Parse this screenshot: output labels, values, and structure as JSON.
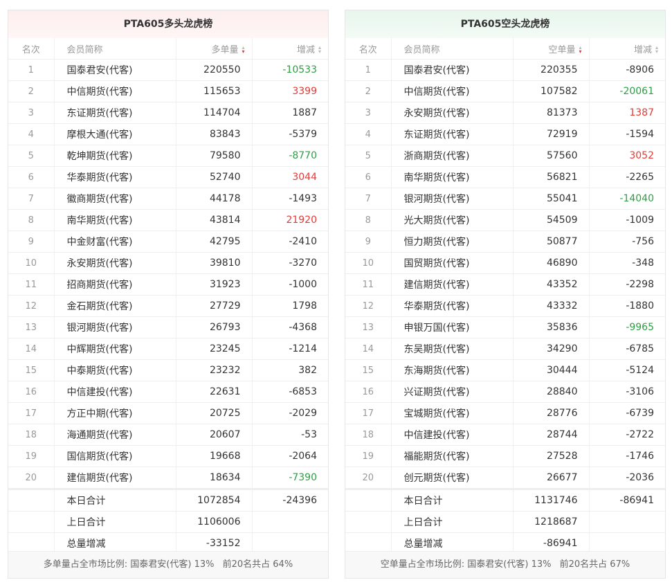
{
  "long": {
    "title": "PTA605多头龙虎榜",
    "headers": {
      "rank": "名次",
      "name": "会员简称",
      "vol": "多单量",
      "chg": "增减"
    },
    "rows": [
      {
        "rank": "1",
        "name": "国泰君安(代客)",
        "vol": "220550",
        "chg": "-10533",
        "dir": "down"
      },
      {
        "rank": "2",
        "name": "中信期货(代客)",
        "vol": "115653",
        "chg": "3399",
        "dir": "up"
      },
      {
        "rank": "3",
        "name": "东证期货(代客)",
        "vol": "114704",
        "chg": "1887",
        "dir": ""
      },
      {
        "rank": "4",
        "name": "摩根大通(代客)",
        "vol": "83843",
        "chg": "-5379",
        "dir": ""
      },
      {
        "rank": "5",
        "name": "乾坤期货(代客)",
        "vol": "79580",
        "chg": "-8770",
        "dir": "down"
      },
      {
        "rank": "6",
        "name": "华泰期货(代客)",
        "vol": "52740",
        "chg": "3044",
        "dir": "up"
      },
      {
        "rank": "7",
        "name": "徽商期货(代客)",
        "vol": "44178",
        "chg": "-1493",
        "dir": ""
      },
      {
        "rank": "8",
        "name": "南华期货(代客)",
        "vol": "43814",
        "chg": "21920",
        "dir": "up"
      },
      {
        "rank": "9",
        "name": "中金财富(代客)",
        "vol": "42795",
        "chg": "-2410",
        "dir": ""
      },
      {
        "rank": "10",
        "name": "永安期货(代客)",
        "vol": "39810",
        "chg": "-3270",
        "dir": ""
      },
      {
        "rank": "11",
        "name": "招商期货(代客)",
        "vol": "31923",
        "chg": "-1000",
        "dir": ""
      },
      {
        "rank": "12",
        "name": "金石期货(代客)",
        "vol": "27729",
        "chg": "1798",
        "dir": ""
      },
      {
        "rank": "13",
        "name": "银河期货(代客)",
        "vol": "26793",
        "chg": "-4368",
        "dir": ""
      },
      {
        "rank": "14",
        "name": "中辉期货(代客)",
        "vol": "23245",
        "chg": "-1214",
        "dir": ""
      },
      {
        "rank": "15",
        "name": "中泰期货(代客)",
        "vol": "23232",
        "chg": "382",
        "dir": ""
      },
      {
        "rank": "16",
        "name": "中信建投(代客)",
        "vol": "22631",
        "chg": "-6853",
        "dir": ""
      },
      {
        "rank": "17",
        "name": "方正中期(代客)",
        "vol": "20725",
        "chg": "-2029",
        "dir": ""
      },
      {
        "rank": "18",
        "name": "海通期货(代客)",
        "vol": "20607",
        "chg": "-53",
        "dir": ""
      },
      {
        "rank": "19",
        "name": "国信期货(代客)",
        "vol": "19668",
        "chg": "-2064",
        "dir": ""
      },
      {
        "rank": "20",
        "name": "建信期货(代客)",
        "vol": "18634",
        "chg": "-7390",
        "dir": "down"
      }
    ],
    "summary": [
      {
        "label": "本日合计",
        "vol": "1072854",
        "chg": "-24396"
      },
      {
        "label": "上日合计",
        "vol": "1106006",
        "chg": ""
      },
      {
        "label": "总量增减",
        "vol": "-33152",
        "chg": ""
      }
    ],
    "footer": {
      "ratio": "多单量占全市场比例: 国泰君安(代客) 13%",
      "top20": "前20名共占 64%"
    }
  },
  "short": {
    "title": "PTA605空头龙虎榜",
    "headers": {
      "rank": "名次",
      "name": "会员简称",
      "vol": "空单量",
      "chg": "增减"
    },
    "rows": [
      {
        "rank": "1",
        "name": "国泰君安(代客)",
        "vol": "220355",
        "chg": "-8906",
        "dir": ""
      },
      {
        "rank": "2",
        "name": "中信期货(代客)",
        "vol": "107582",
        "chg": "-20061",
        "dir": "down"
      },
      {
        "rank": "3",
        "name": "永安期货(代客)",
        "vol": "81373",
        "chg": "1387",
        "dir": "up"
      },
      {
        "rank": "4",
        "name": "东证期货(代客)",
        "vol": "72919",
        "chg": "-1594",
        "dir": ""
      },
      {
        "rank": "5",
        "name": "浙商期货(代客)",
        "vol": "57560",
        "chg": "3052",
        "dir": "up"
      },
      {
        "rank": "6",
        "name": "南华期货(代客)",
        "vol": "56821",
        "chg": "-2265",
        "dir": ""
      },
      {
        "rank": "7",
        "name": "银河期货(代客)",
        "vol": "55041",
        "chg": "-14040",
        "dir": "down"
      },
      {
        "rank": "8",
        "name": "光大期货(代客)",
        "vol": "54509",
        "chg": "-1009",
        "dir": ""
      },
      {
        "rank": "9",
        "name": "恒力期货(代客)",
        "vol": "50877",
        "chg": "-756",
        "dir": ""
      },
      {
        "rank": "10",
        "name": "国贸期货(代客)",
        "vol": "46890",
        "chg": "-348",
        "dir": ""
      },
      {
        "rank": "11",
        "name": "建信期货(代客)",
        "vol": "43352",
        "chg": "-2298",
        "dir": ""
      },
      {
        "rank": "12",
        "name": "华泰期货(代客)",
        "vol": "43332",
        "chg": "-1880",
        "dir": ""
      },
      {
        "rank": "13",
        "name": "申银万国(代客)",
        "vol": "35836",
        "chg": "-9965",
        "dir": "down"
      },
      {
        "rank": "14",
        "name": "东吴期货(代客)",
        "vol": "34290",
        "chg": "-6785",
        "dir": ""
      },
      {
        "rank": "15",
        "name": "东海期货(代客)",
        "vol": "30444",
        "chg": "-5124",
        "dir": ""
      },
      {
        "rank": "16",
        "name": "兴证期货(代客)",
        "vol": "28840",
        "chg": "-3106",
        "dir": ""
      },
      {
        "rank": "17",
        "name": "宝城期货(代客)",
        "vol": "28776",
        "chg": "-6739",
        "dir": ""
      },
      {
        "rank": "18",
        "name": "中信建投(代客)",
        "vol": "28744",
        "chg": "-2722",
        "dir": ""
      },
      {
        "rank": "19",
        "name": "福能期货(代客)",
        "vol": "27528",
        "chg": "-1746",
        "dir": ""
      },
      {
        "rank": "20",
        "name": "创元期货(代客)",
        "vol": "26677",
        "chg": "-2036",
        "dir": ""
      }
    ],
    "summary": [
      {
        "label": "本日合计",
        "vol": "1131746",
        "chg": "-86941"
      },
      {
        "label": "上日合计",
        "vol": "1218687",
        "chg": ""
      },
      {
        "label": "总量增减",
        "vol": "-86941",
        "chg": ""
      }
    ],
    "footer": {
      "ratio": "空单量占全市场比例: 国泰君安(代客) 13%",
      "top20": "前20名共占 67%"
    }
  }
}
